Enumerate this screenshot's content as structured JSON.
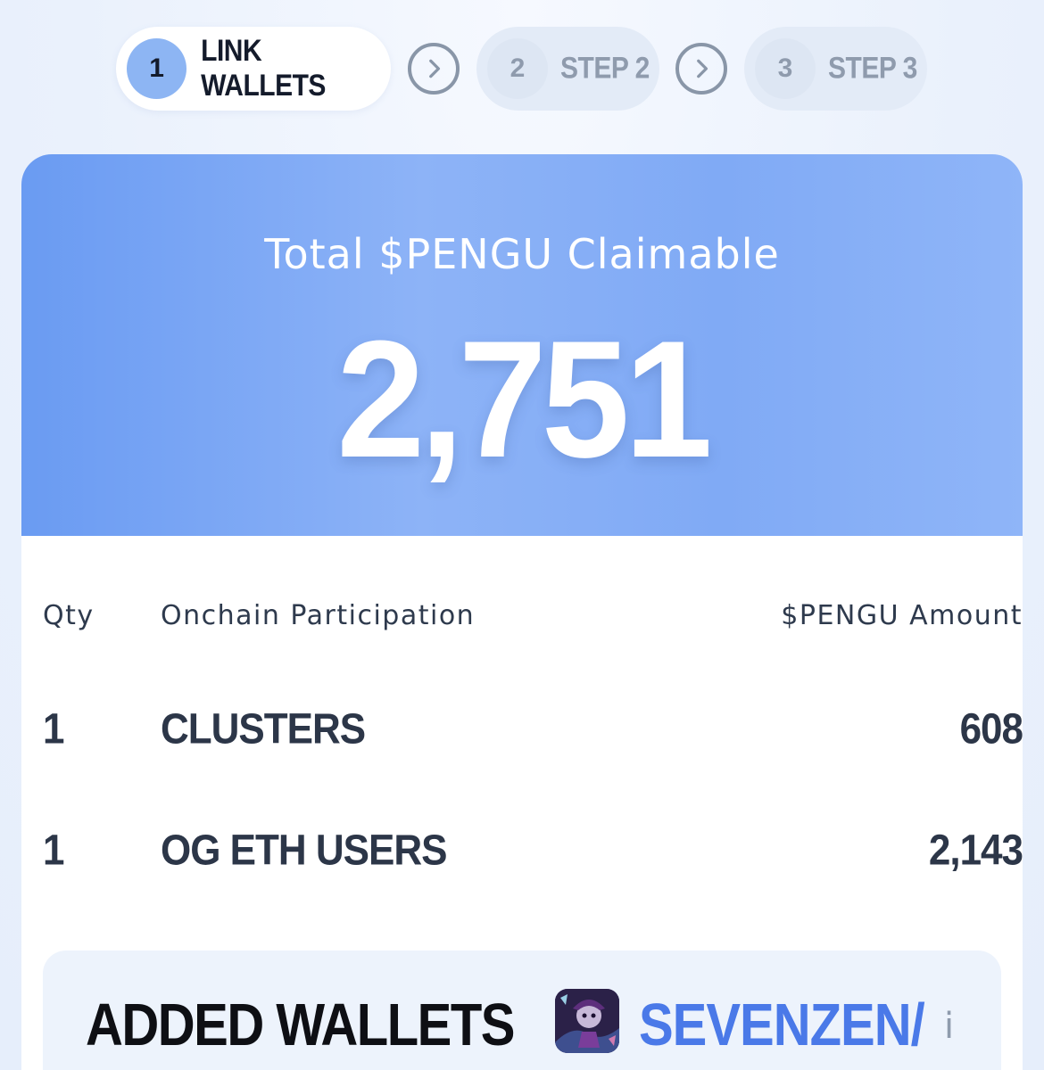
{
  "stepper": {
    "steps": [
      {
        "number": "1",
        "label": "LINK WALLETS",
        "active": true
      },
      {
        "number": "2",
        "label": "STEP 2",
        "active": false
      },
      {
        "number": "3",
        "label": "STEP 3",
        "active": false
      }
    ],
    "separator_icon": "chevron-right-icon"
  },
  "hero": {
    "title": "Total $PENGU Claimable",
    "total": "2,751"
  },
  "table": {
    "headers": {
      "qty": "Qty",
      "participation": "Onchain Participation",
      "amount": "$PENGU Amount"
    },
    "rows": [
      {
        "qty": "1",
        "participation": "CLUSTERS",
        "amount": "608"
      },
      {
        "qty": "1",
        "participation": "OG ETH USERS",
        "amount": "2,143"
      }
    ]
  },
  "wallets": {
    "title": "ADDED WALLETS",
    "name": "SEVENZEN/",
    "info_icon": "i"
  },
  "colors": {
    "accent": "#8db5f3",
    "hero_start": "#6a9bf2",
    "hero_end": "#8fb5f8",
    "wallet_name": "#4a79e8",
    "text_dark": "#2c3648"
  }
}
